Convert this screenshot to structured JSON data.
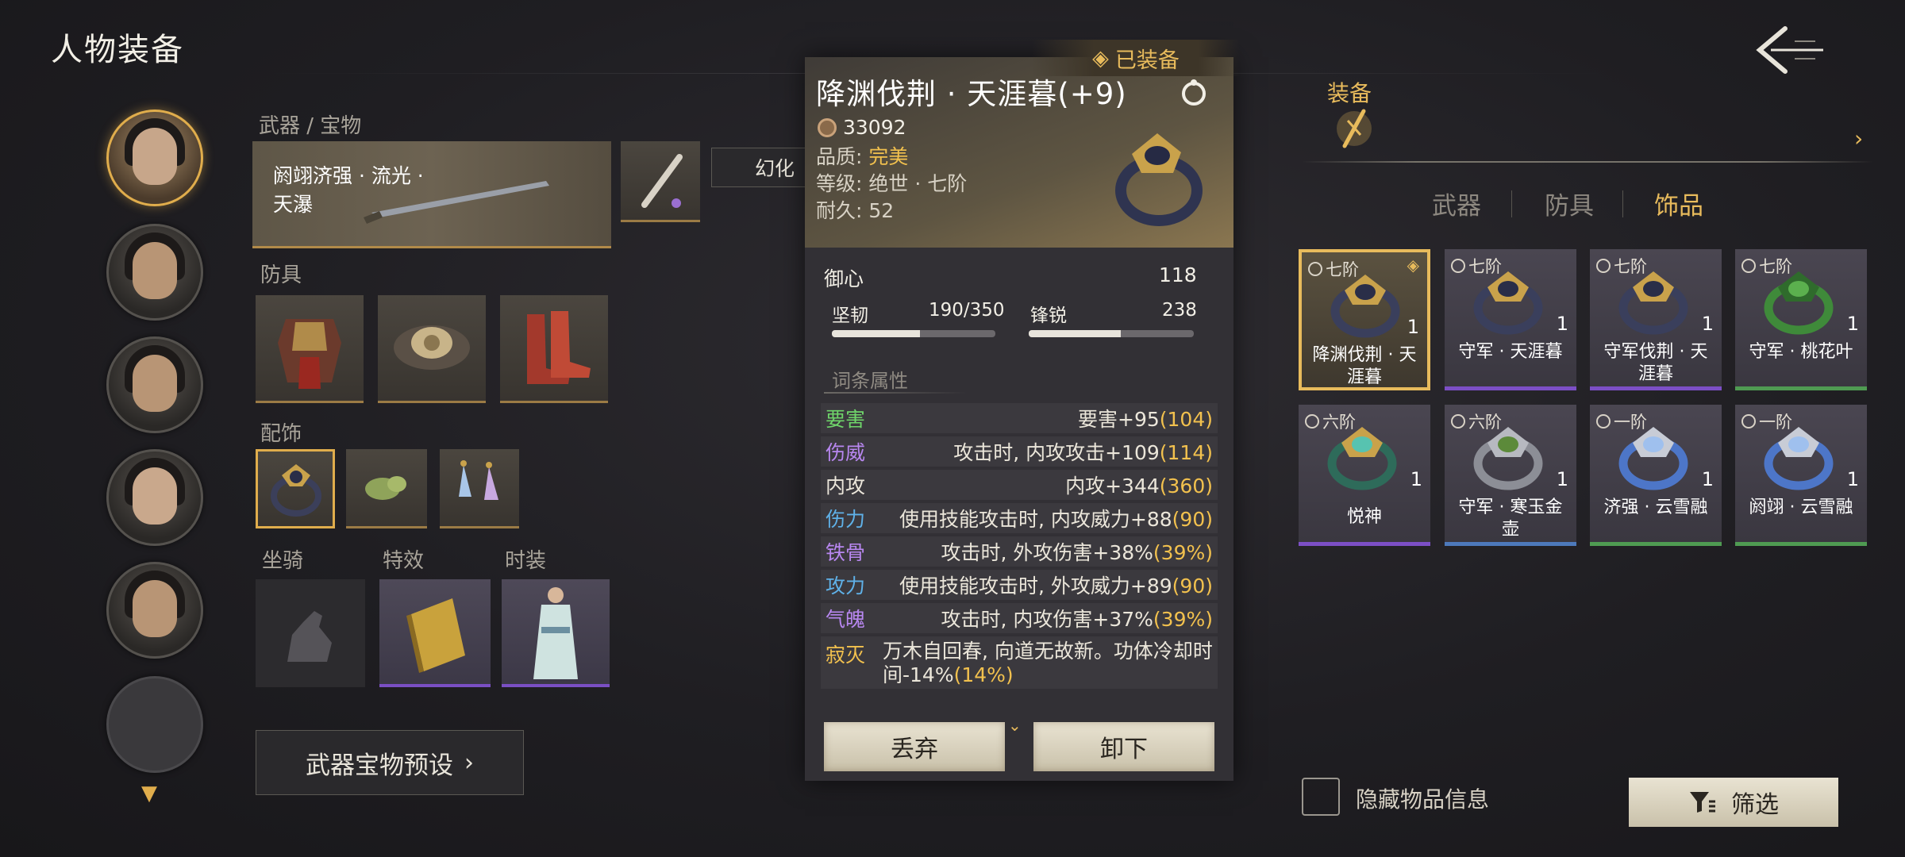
{
  "header": {
    "title": "人物装备"
  },
  "left_panel": {
    "weapon_section_label": "武器 / 宝物",
    "weapon_name": "阏翊济强 · 流光 · 天瀑",
    "huanhua_label": "幻化",
    "armor_label": "防具",
    "accessory_label": "配饰",
    "mount_label": "坐骑",
    "effect_label": "特效",
    "fashion_label": "时装",
    "preset_button": "武器宝物预设"
  },
  "detail": {
    "equipped_tag": "已装备",
    "name": "降渊伐荆 · 天涯暮(+9)",
    "score": "33092",
    "quality_label": "品质:",
    "quality_value": "完美",
    "level_line": "等级: 绝世 · 七阶",
    "durability_line": "耐久: 52",
    "yuxin_label": "御心",
    "yuxin_value": "118",
    "jianren_label": "坚韧",
    "jianren_value": "190/350",
    "jianren_fill": 0.54,
    "fengrui_label": "锋锐",
    "fengrui_value": "238",
    "fengrui_fill": 0.56,
    "attr_header": "词条属性",
    "attributes": [
      {
        "name": "要害",
        "color": "#6fd56a",
        "text": "要害+95",
        "bonus": "(104)"
      },
      {
        "name": "伤威",
        "color": "#b887f0",
        "text": "攻击时, 内攻攻击+109",
        "bonus": "(114)"
      },
      {
        "name": "内攻",
        "color": "#ebe6da",
        "text": "内攻+344",
        "bonus": "(360)"
      },
      {
        "name": "伤力",
        "color": "#5fb1e8",
        "text": "使用技能攻击时, 内攻威力+88",
        "bonus": "(90)"
      },
      {
        "name": "铁骨",
        "color": "#b887f0",
        "text": "攻击时, 外攻伤害+38%",
        "bonus": "(39%)"
      },
      {
        "name": "攻力",
        "color": "#5fb1e8",
        "text": "使用技能攻击时, 外攻威力+89",
        "bonus": "(90)"
      },
      {
        "name": "气魄",
        "color": "#b887f0",
        "text": "攻击时, 内攻伤害+37%",
        "bonus": "(39%)"
      },
      {
        "name": "寂灭",
        "color": "#f2c14e",
        "text": "万木自回春, 向道无故新。功体冷却时间-14%",
        "bonus": "(14%)"
      }
    ],
    "discard_button": "丢弃",
    "unequip_button": "卸下"
  },
  "right_panel": {
    "equip_title": "装备",
    "tabs": [
      "武器",
      "防具",
      "饰品"
    ],
    "active_tab": "饰品",
    "items": [
      {
        "grade": "七阶",
        "count": "1",
        "name": "降渊伐荆 · 天涯暮",
        "rarity": "selected"
      },
      {
        "grade": "七阶",
        "count": "1",
        "name": "守军 · 天涯暮",
        "rarity": "purple"
      },
      {
        "grade": "七阶",
        "count": "1",
        "name": "守军伐荆 · 天涯暮",
        "rarity": "purple"
      },
      {
        "grade": "七阶",
        "count": "1",
        "name": "守军 · 桃花叶",
        "rarity": "green"
      },
      {
        "grade": "六阶",
        "count": "1",
        "name": "悦神",
        "rarity": "purple"
      },
      {
        "grade": "六阶",
        "count": "1",
        "name": "守军 · 寒玉金壶",
        "rarity": "blue"
      },
      {
        "grade": "一阶",
        "count": "1",
        "name": "济强 · 云雪融",
        "rarity": "green"
      },
      {
        "grade": "一阶",
        "count": "1",
        "name": "阏翊 · 云雪融",
        "rarity": "green"
      }
    ],
    "hide_info_label": "隐藏物品信息",
    "filter_button": "筛选"
  }
}
